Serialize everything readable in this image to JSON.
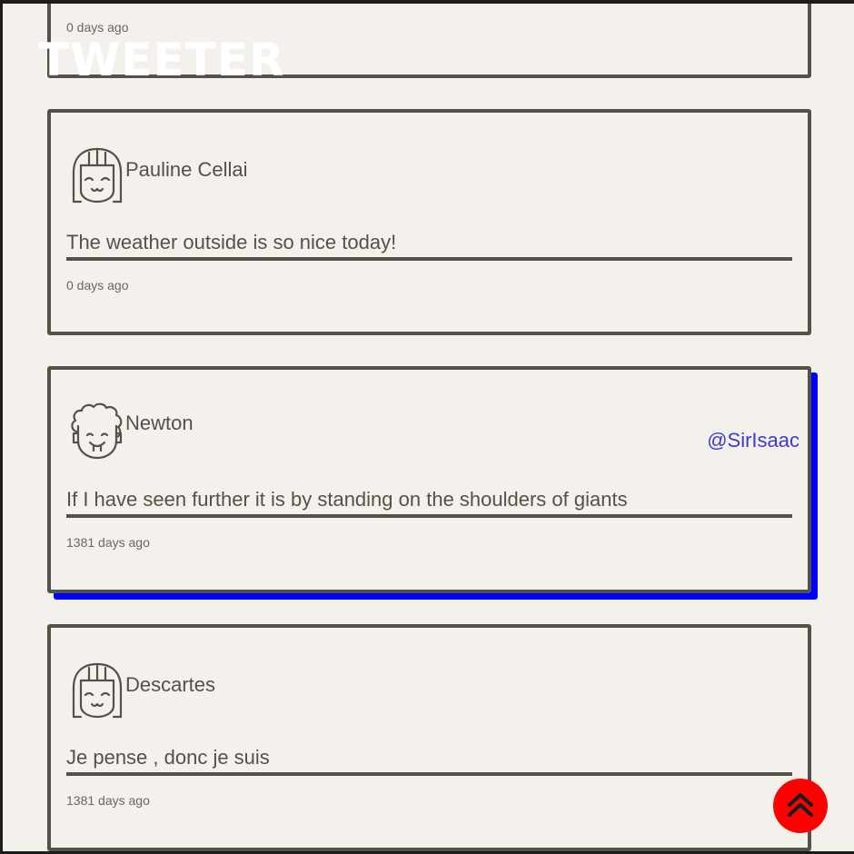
{
  "app": {
    "brand": "TWEETER"
  },
  "tweets": [
    {
      "avatar": "girl-avatar-icon",
      "name": "",
      "handle": "",
      "content": "",
      "time": "0 days ago"
    },
    {
      "avatar": "girl-avatar-icon",
      "name": "Pauline Cellai",
      "handle": "",
      "content": "The weather outside is so nice today!",
      "time": "0 days ago"
    },
    {
      "avatar": "curly-hair-avatar-icon",
      "name": "Newton",
      "handle": "@SirIsaac",
      "content": "If I have seen further it is by standing on the shoulders of giants",
      "time": "1381 days ago"
    },
    {
      "avatar": "girl-avatar-icon",
      "name": "Descartes",
      "handle": "",
      "content": "Je pense , donc je suis",
      "time": "1381 days ago"
    }
  ],
  "scroll_top_button": {
    "icon": "double-chevron-up-icon",
    "color": "#ff0000"
  },
  "colors": {
    "background": "#f4f1ed",
    "border": "#545149",
    "accent_shadow": "#0000ff",
    "handle": "#3b3bd1"
  }
}
